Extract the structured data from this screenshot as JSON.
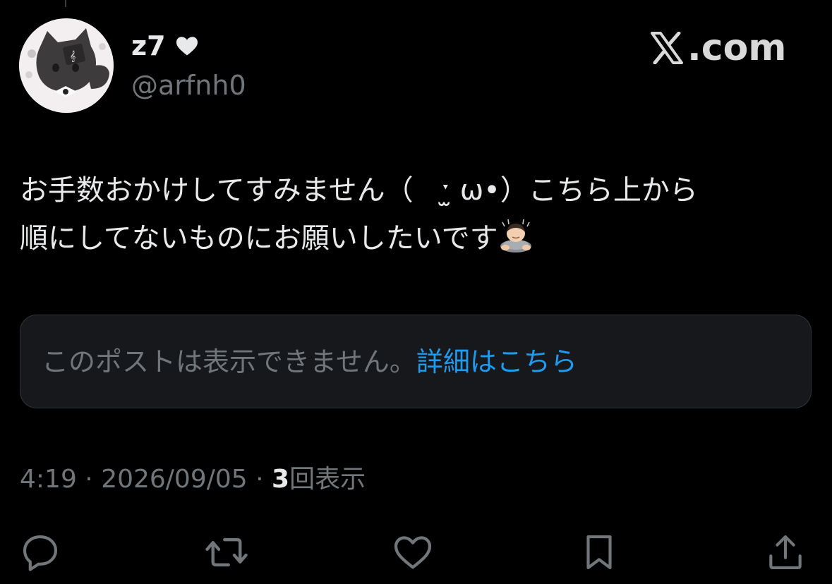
{
  "author": {
    "display_name": "z7",
    "badge_icon": "heart-icon",
    "handle": "@arfnh0"
  },
  "site_logo": {
    "text": ".com",
    "icon": "x-logo-icon"
  },
  "tweet": {
    "line1": "お手数おかけしてすみません（　ˑ̫ ω•）こちら上から",
    "line2": "順にしてないものにお願いしたいです",
    "emoji": "person-bowing-icon"
  },
  "quoted_post": {
    "unavailable_text": "このポストは表示できません。",
    "link_text": "詳細はこちら",
    "link_color": "#1d9bf0"
  },
  "meta": {
    "time": "4:19",
    "separator": " · ",
    "date": "2026/09/05",
    "view_count": "3",
    "views_label": "回表示"
  },
  "actions": [
    "reply-icon",
    "retweet-icon",
    "like-icon",
    "bookmark-icon",
    "share-icon"
  ],
  "colors": {
    "background": "#000000",
    "text": "#e7e9ea",
    "muted": "#71767b",
    "accent": "#1d9bf0"
  }
}
